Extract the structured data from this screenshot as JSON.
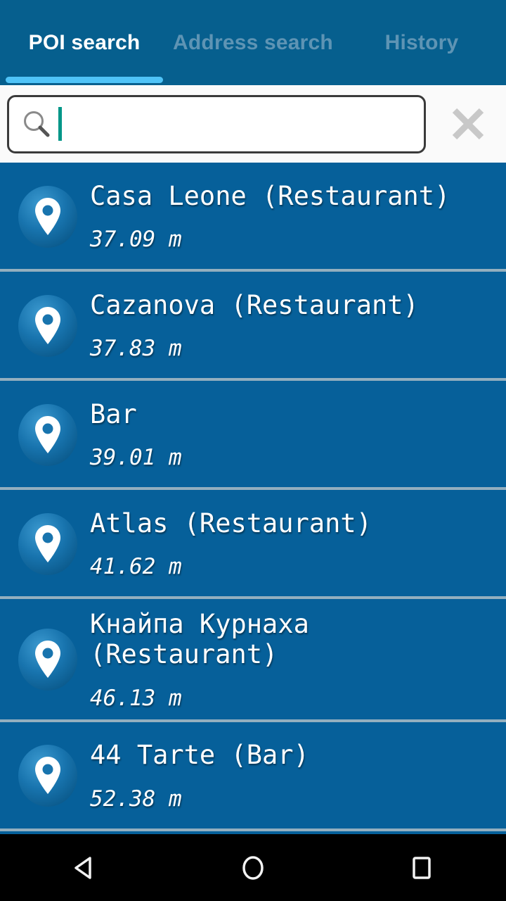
{
  "tabs": [
    {
      "label": "POI search",
      "active": true
    },
    {
      "label": "Address search",
      "active": false
    },
    {
      "label": "History",
      "active": false
    }
  ],
  "search": {
    "value": "",
    "placeholder": "",
    "search_icon": "search-icon",
    "clear_icon": "close-icon",
    "clear_label": "Clear"
  },
  "results": [
    {
      "name": "Casa Leone (Restaurant)",
      "distance": "37.09 m",
      "icon": "map-pin-icon"
    },
    {
      "name": "Cazanova (Restaurant)",
      "distance": "37.83 m",
      "icon": "map-pin-icon"
    },
    {
      "name": "Bar",
      "distance": "39.01 m",
      "icon": "map-pin-icon"
    },
    {
      "name": "Atlas (Restaurant)",
      "distance": "41.62 m",
      "icon": "map-pin-icon"
    },
    {
      "name": "Кнайпа Курнаха (Restaurant)",
      "distance": "46.13 m",
      "icon": "map-pin-icon"
    },
    {
      "name": "44 Tarte (Bar)",
      "distance": "52.38 m",
      "icon": "map-pin-icon"
    }
  ],
  "navbar": {
    "back": "back-triangle-icon",
    "home": "home-circle-icon",
    "recents": "recents-square-icon"
  },
  "colors": {
    "header_blue": "#065F8E",
    "list_blue": "#06609A",
    "active_tab_text": "#FFFFFF",
    "inactive_tab_text": "#5E94B4",
    "tab_indicator": "#4FC3F7",
    "divider": "#93AFBF",
    "caret_teal": "#009688",
    "navbar_black": "#000000",
    "search_bg": "#FAFAFA"
  }
}
